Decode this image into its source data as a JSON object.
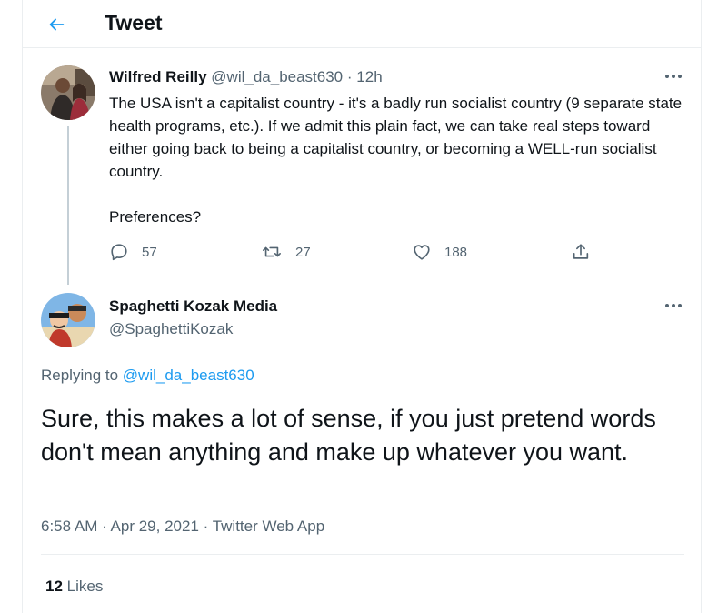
{
  "header": {
    "title": "Tweet",
    "back_icon": "arrow-left-icon",
    "accent_color": "#1d9bf0"
  },
  "parent_tweet": {
    "author_name": "Wilfred Reilly",
    "handle": "@wil_da_beast630",
    "separator": "·",
    "time": "12h",
    "paragraphs": [
      "The USA isn't a capitalist country - it's a badly run socialist country (9 separate state health programs, etc.). If we admit this plain fact, we can take real steps toward either going back to being a capitalist country, or becoming a WELL-run socialist country.",
      "Preferences?"
    ],
    "actions": {
      "replies": "57",
      "retweets": "27",
      "likes": "188"
    }
  },
  "reply_tweet": {
    "author_name": "Spaghetti Kozak Media",
    "handle": "@SpaghettiKozak",
    "replying_prefix": "Replying to",
    "replying_to": "@wil_da_beast630",
    "text": "Sure, this makes a lot of sense, if you just pretend words don't mean anything and make up whatever you want.",
    "timestamp": "6:58 AM · Apr 29, 2021 · Twitter Web App",
    "likes_count": "12",
    "likes_label": "Likes"
  }
}
